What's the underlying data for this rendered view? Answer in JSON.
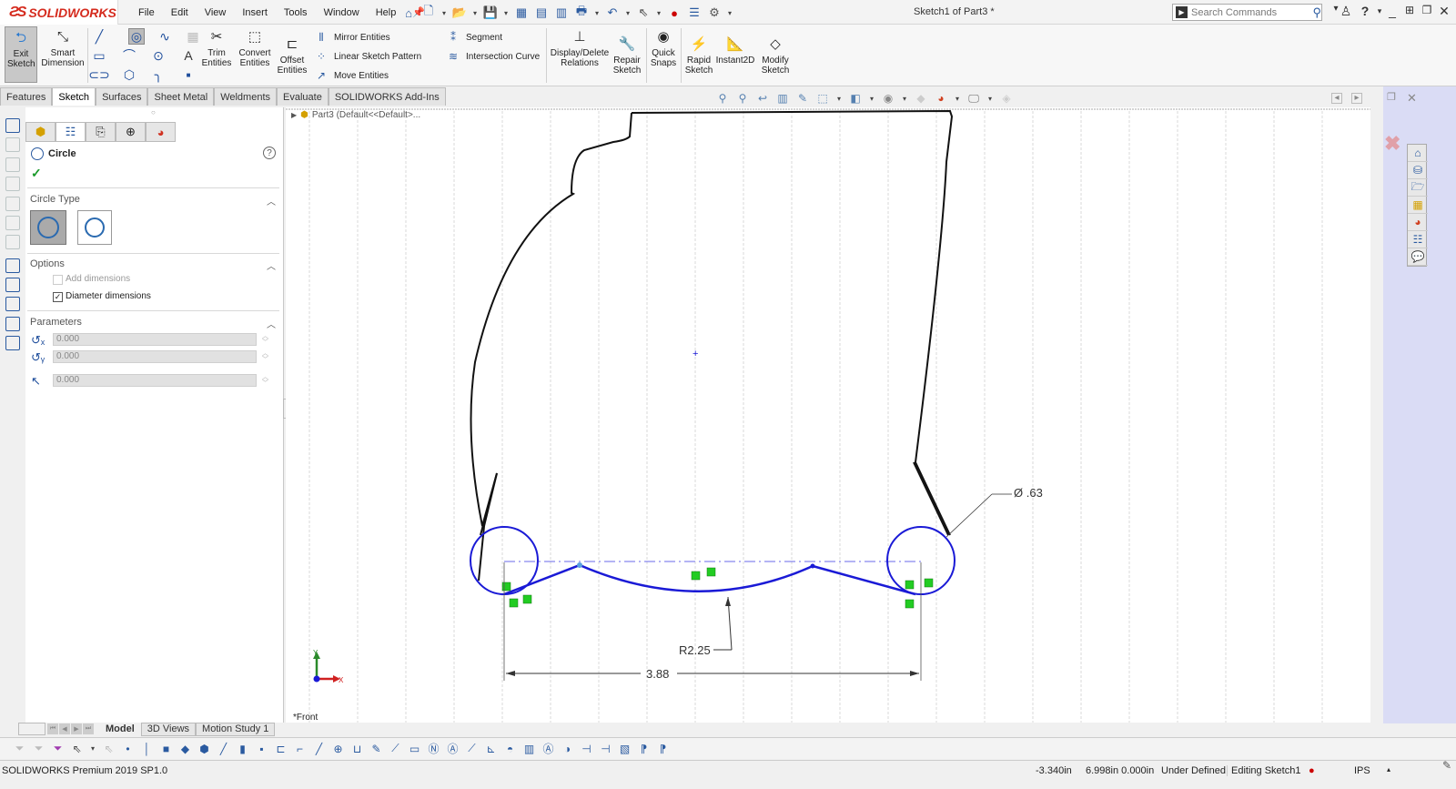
{
  "app": {
    "brand": "SOLIDWORKS",
    "brand_prefix": "3S",
    "document_title": "Sketch1 of Part3 *",
    "brand_color": "#d52b1e",
    "sketch_color": "#1a1ad6"
  },
  "menu": [
    "File",
    "Edit",
    "View",
    "Insert",
    "Tools",
    "Window",
    "Help"
  ],
  "search": {
    "placeholder": "Search Commands"
  },
  "command_manager": {
    "exit_sketch": "Exit Sketch",
    "smart_dimension": "Smart Dimension",
    "trim_entities": "Trim Entities",
    "convert_entities": "Convert Entities",
    "offset_entities": "Offset Entities",
    "mirror_entities": "Mirror Entities",
    "linear_sketch_pattern": "Linear Sketch Pattern",
    "move_entities": "Move Entities",
    "segment": "Segment",
    "intersection_curve": "Intersection Curve",
    "display_delete_relations": "Display/Delete Relations",
    "repair_sketch": "Repair Sketch",
    "quick_snaps": "Quick Snaps",
    "rapid_sketch": "Rapid Sketch",
    "instant2d": "Instant2D",
    "modify_sketch": "Modify Sketch"
  },
  "tabs": [
    {
      "label": "Features",
      "active": false
    },
    {
      "label": "Sketch",
      "active": true
    },
    {
      "label": "Surfaces",
      "active": false
    },
    {
      "label": "Sheet Metal",
      "active": false
    },
    {
      "label": "Weldments",
      "active": false
    },
    {
      "label": "Evaluate",
      "active": false
    },
    {
      "label": "SOLIDWORKS Add-Ins",
      "active": false
    }
  ],
  "property_manager": {
    "title": "Circle",
    "circle_type": {
      "title": "Circle Type",
      "options": [
        "Center circle",
        "Perimeter circle"
      ],
      "selected": "Center circle"
    },
    "options": {
      "title": "Options",
      "add_dimensions": {
        "label": "Add dimensions",
        "checked": false,
        "enabled": false
      },
      "diameter_dimensions": {
        "label": "Diameter dimensions",
        "checked": true
      }
    },
    "parameters": {
      "title": "Parameters",
      "center_x": "0.000",
      "center_y": "0.000",
      "radius": "0.000"
    }
  },
  "feature_tree": {
    "root": "Part3  (Default<<Default>..."
  },
  "graphics": {
    "dim_width": "3.88",
    "dim_radius": "R2.25",
    "dim_diameter": "Ø .63",
    "view_label": "*Front",
    "axis_x": "X",
    "axis_y": "Y"
  },
  "bottom_tabs": [
    {
      "label": "Model",
      "active": true
    },
    {
      "label": "3D Views",
      "active": false
    },
    {
      "label": "Motion Study 1",
      "active": false
    }
  ],
  "status": {
    "version": "SOLIDWORKS Premium 2019 SP1.0",
    "x": "-3.340in",
    "yz": "6.998in 0.000in",
    "definition": "Under Defined",
    "editing": "Editing Sketch1",
    "units": "IPS"
  }
}
